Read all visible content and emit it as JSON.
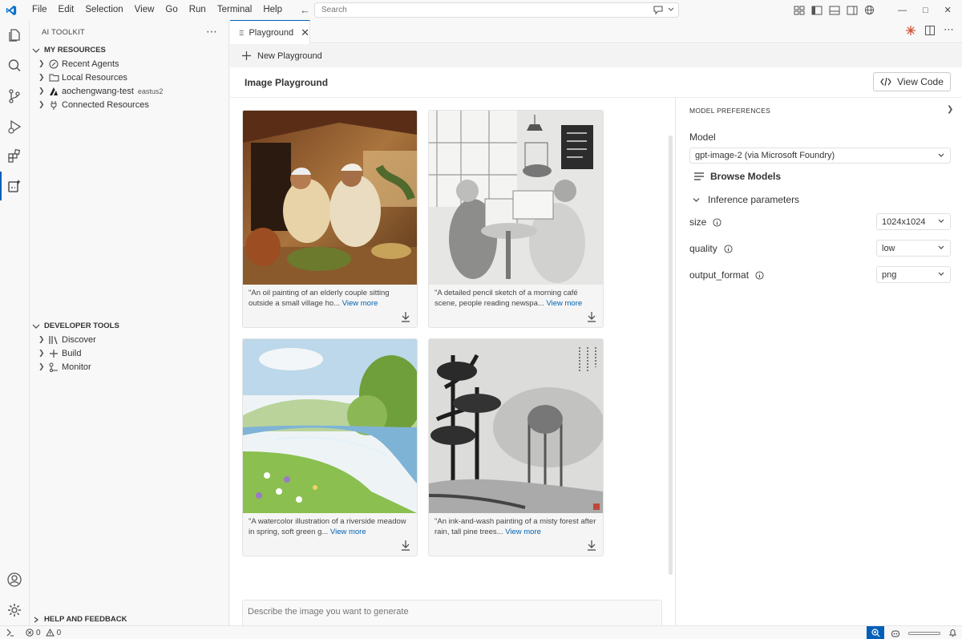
{
  "menu": [
    "File",
    "Edit",
    "Selection",
    "View",
    "Go",
    "Run",
    "Terminal",
    "Help"
  ],
  "search": {
    "placeholder": "Search"
  },
  "sidebar": {
    "title": "AI TOOLKIT",
    "my_resources": {
      "label": "MY RESOURCES",
      "items": [
        {
          "label": "Recent Agents",
          "icon": "agent-icon"
        },
        {
          "label": "Local Resources",
          "icon": "folder-icon"
        },
        {
          "label": "aochengwang-test",
          "sub": "eastus2",
          "icon": "foundry-icon"
        },
        {
          "label": "Connected Resources",
          "icon": "plug-icon"
        }
      ]
    },
    "developer_tools": {
      "label": "DEVELOPER TOOLS",
      "items": [
        {
          "label": "Discover",
          "icon": "library-icon"
        },
        {
          "label": "Build",
          "icon": "plus-icon"
        },
        {
          "label": "Monitor",
          "icon": "monitor-icon"
        }
      ]
    },
    "help": {
      "label": "HELP AND FEEDBACK"
    }
  },
  "tabs": [
    {
      "label": "Playground"
    }
  ],
  "new_playground": "New Playground",
  "page": {
    "title": "Image Playground",
    "view_code": "View Code",
    "view_more": "View More",
    "prompt_placeholder": "Describe the image you want to generate"
  },
  "gallery": [
    {
      "caption": "\"An oil painting of an elderly couple sitting outside a small village ho...",
      "more": "View more"
    },
    {
      "caption": "\"A detailed pencil sketch of a morning café scene, people reading newspa...",
      "more": "View more"
    },
    {
      "caption": "\"A watercolor illustration of a riverside meadow in spring, soft green g...",
      "more": "View more"
    },
    {
      "caption": "\"An ink-and-wash painting of a misty forest after rain, tall pine trees...",
      "more": "View more"
    }
  ],
  "prefs": {
    "title": "MODEL PREFERENCES",
    "model_label": "Model",
    "model_value": "gpt-image-2 (via Microsoft Foundry)",
    "browse_models": "Browse Models",
    "inference": "Inference parameters",
    "params": [
      {
        "label": "size",
        "value": "1024x1024"
      },
      {
        "label": "quality",
        "value": "low"
      },
      {
        "label": "output_format",
        "value": "png"
      }
    ]
  },
  "status": {
    "errors": "0",
    "warnings": "0"
  },
  "colors": {
    "accent": "#005fb8",
    "link": "#0062b1"
  }
}
